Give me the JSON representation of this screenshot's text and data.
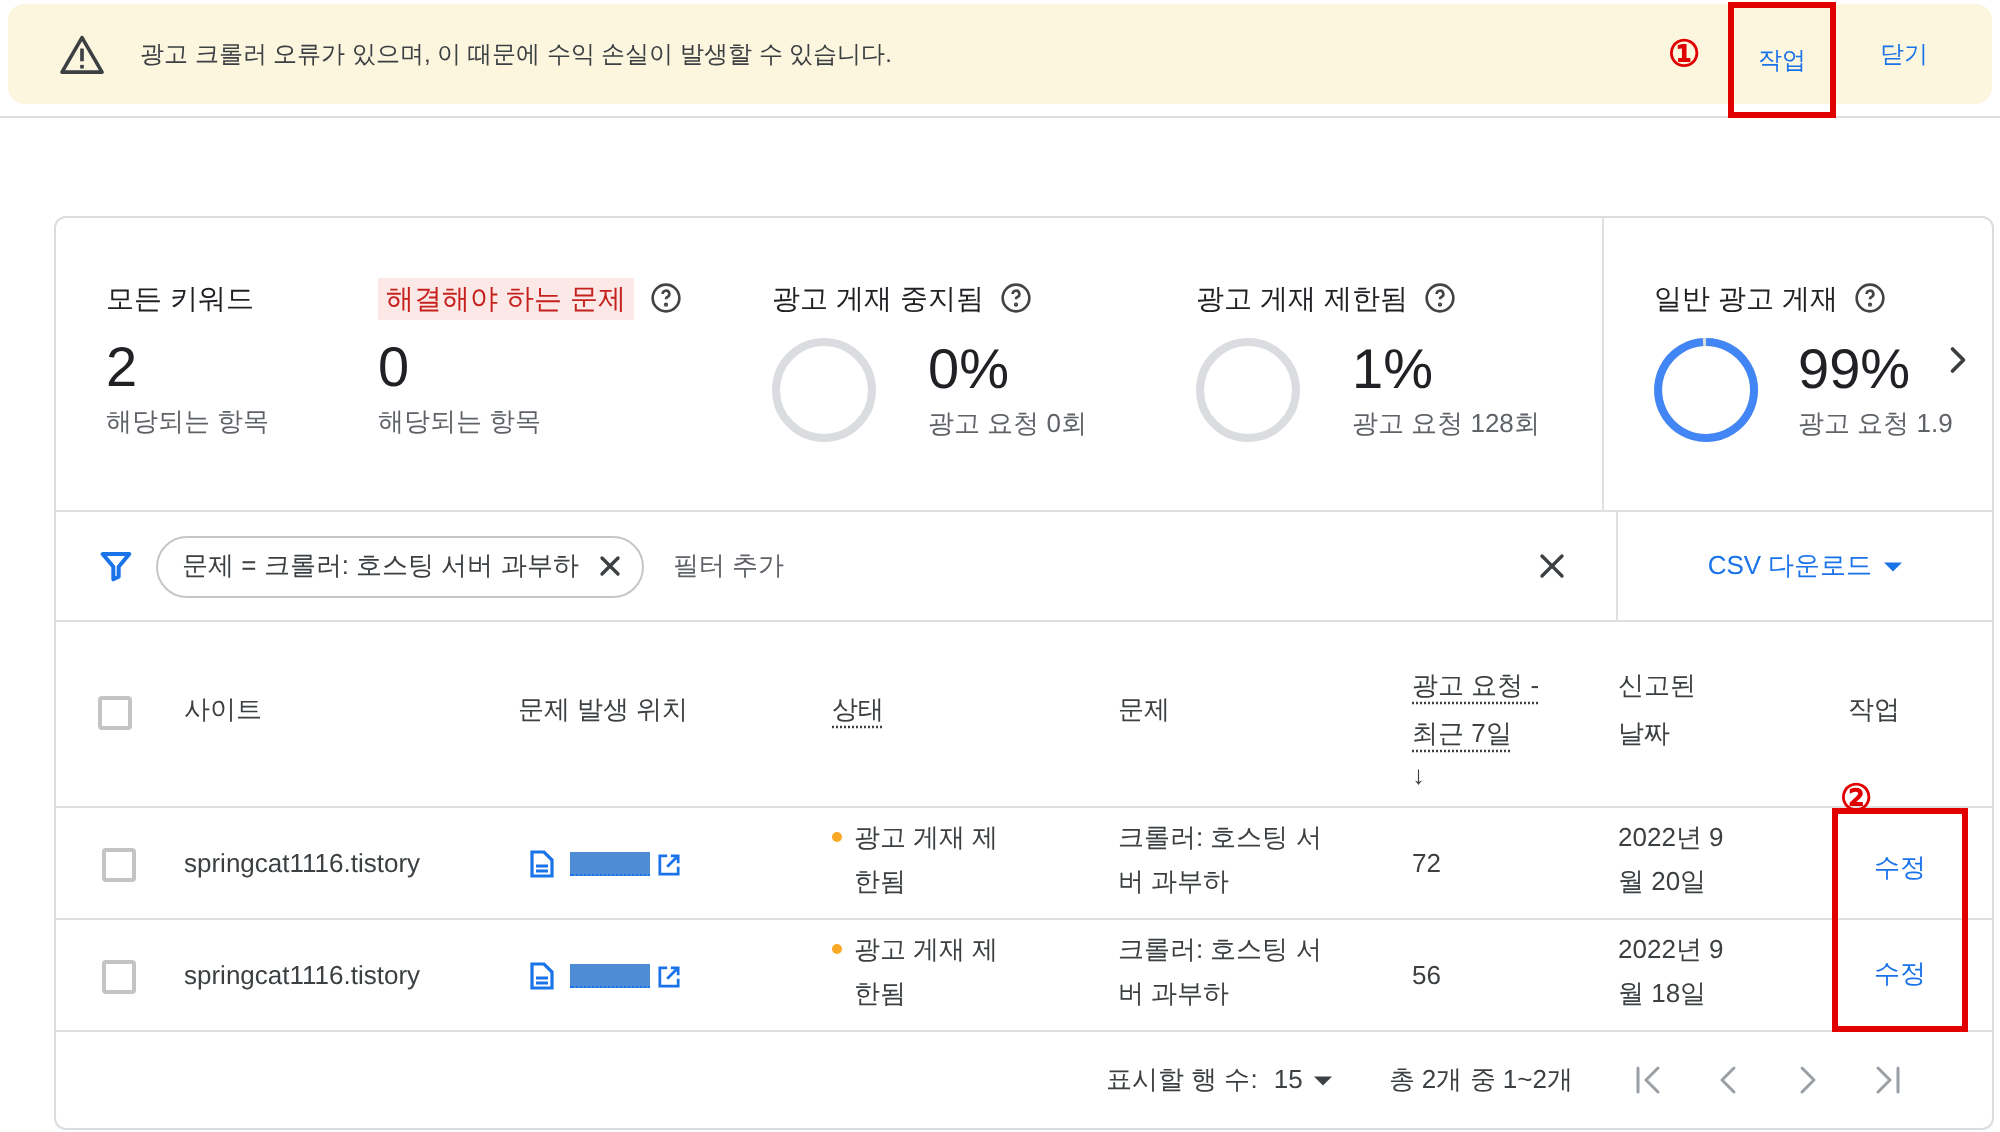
{
  "banner": {
    "message": "광고 크롤러 오류가 있으며, 이 때문에 수익 손실이 발생할 수 있습니다.",
    "marker": "①",
    "actions": [
      {
        "label": "작업",
        "highlighted": true
      },
      {
        "label": "닫기",
        "highlighted": false
      }
    ]
  },
  "summary": [
    {
      "kind": "count",
      "title": "모든 키워드",
      "flagged": false,
      "value": "2",
      "caption": "해당되는 항목"
    },
    {
      "kind": "count",
      "title": "해결해야 하는 문제",
      "flagged": true,
      "value": "0",
      "caption": "해당되는 항목"
    },
    {
      "kind": "ring",
      "title": "광고 게재 중지됨",
      "value": "0%",
      "caption": "광고 요청 0회"
    },
    {
      "kind": "ring",
      "title": "광고 게재 제한됨",
      "value": "1%",
      "caption": "광고 요청 128회"
    },
    {
      "kind": "ring",
      "title": "일반 광고 게재",
      "level": 0.99,
      "value": "99%",
      "caption": "광고 요청 1.9"
    }
  ],
  "filter": {
    "chip": "문제 = 크롤러: 호스팅 서버 과부하",
    "add": "필터 추가",
    "download": "CSV 다운로드"
  },
  "table": {
    "columns": [
      "사이트",
      "문제 발생 위치",
      "상태",
      "문제",
      "광고 요청 - 최근 7일",
      "신고된 날짜",
      "작업"
    ],
    "sort_arrow": "↓",
    "marker": "②",
    "header_checked": false,
    "rows": [
      {
        "checked": false,
        "site": "springcat1116.tistory",
        "status": "광고 게재 제한됨",
        "color": "#f9a825",
        "issue": "크롤러: 호스팅 서버 과부하",
        "requests": "72",
        "date": "2022년 9월 20일",
        "action": "수정"
      },
      {
        "checked": false,
        "site": "springcat1116.tistory",
        "status": "광고 게재 제한됨",
        "color": "#f9a825",
        "issue": "크롤러: 호스팅 서버 과부하",
        "requests": "56",
        "date": "2022년 9월 18일",
        "action": "수정"
      }
    ]
  },
  "pagination": {
    "rows_label": "표시할 행 수:",
    "rows_value": "15",
    "range": "총 2개 중 1~2개"
  }
}
